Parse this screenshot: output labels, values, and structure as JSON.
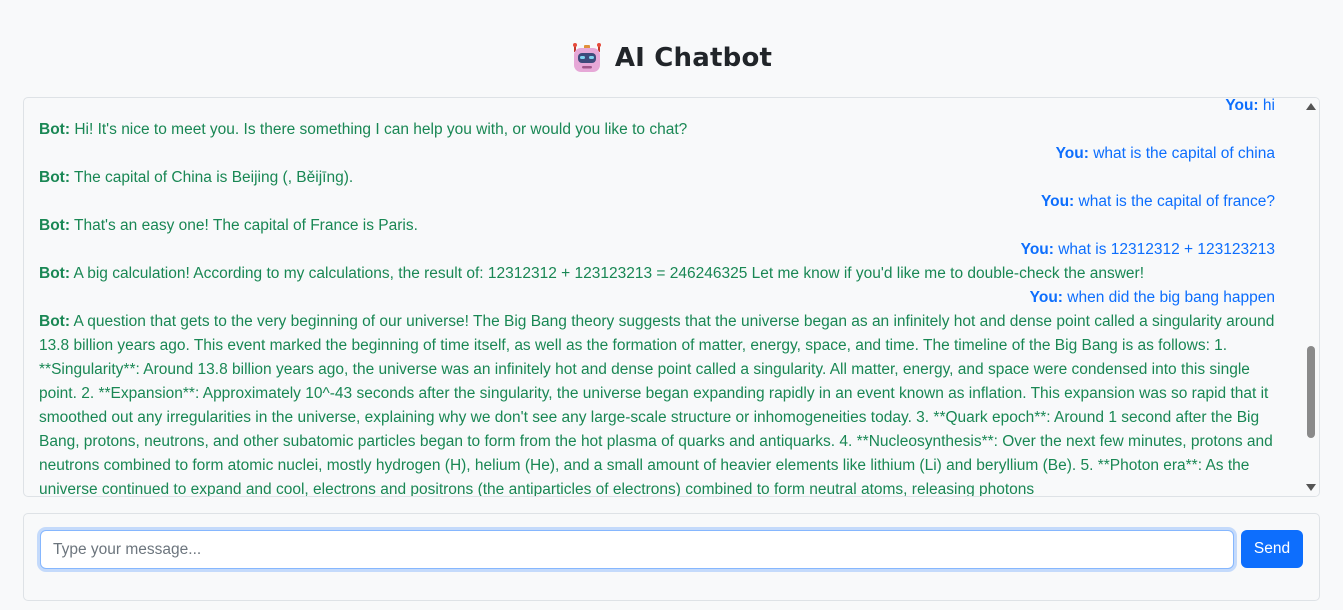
{
  "header": {
    "icon": "robot-icon",
    "title": "AI Chatbot"
  },
  "chat": {
    "user_label": "You:",
    "bot_label": "Bot:",
    "messages": [
      {
        "sender": "user",
        "text": "hi"
      },
      {
        "sender": "bot",
        "text": "Hi! It's nice to meet you. Is there something I can help you with, or would you like to chat?"
      },
      {
        "sender": "user",
        "text": "what is the capital of china"
      },
      {
        "sender": "bot",
        "text": "The capital of China is Beijing (, Běijīng)."
      },
      {
        "sender": "user",
        "text": "what is the capital of france?"
      },
      {
        "sender": "bot",
        "text": "That's an easy one! The capital of France is Paris."
      },
      {
        "sender": "user",
        "text": "what is 12312312 + 123123213"
      },
      {
        "sender": "bot",
        "text": "A big calculation! According to my calculations, the result of: 12312312 + 123123213 = 246246325 Let me know if you'd like me to double-check the answer!"
      },
      {
        "sender": "user",
        "text": "when did the big bang happen"
      },
      {
        "sender": "bot",
        "text": "A question that gets to the very beginning of our universe! The Big Bang theory suggests that the universe began as an infinitely hot and dense point called a singularity around 13.8 billion years ago. This event marked the beginning of time itself, as well as the formation of matter, energy, space, and time. The timeline of the Big Bang is as follows: 1. **Singularity**: Around 13.8 billion years ago, the universe was an infinitely hot and dense point called a singularity. All matter, energy, and space were condensed into this single point. 2. **Expansion**: Approximately 10^-43 seconds after the singularity, the universe began expanding rapidly in an event known as inflation. This expansion was so rapid that it smoothed out any irregularities in the universe, explaining why we don't see any large-scale structure or inhomogeneities today. 3. **Quark epoch**: Around 1 second after the Big Bang, protons, neutrons, and other subatomic particles began to form from the hot plasma of quarks and antiquarks. 4. **Nucleosynthesis**: Over the next few minutes, protons and neutrons combined to form atomic nuclei, mostly hydrogen (H), helium (He), and a small amount of heavier elements like lithium (Li) and beryllium (Be). 5. **Photon era**: As the universe continued to expand and cool, electrons and positrons (the antiparticles of electrons) combined to form neutral atoms, releasing photons"
      }
    ]
  },
  "input": {
    "placeholder": "Type your message...",
    "value": "",
    "send_label": "Send"
  },
  "colors": {
    "user": "#0d6efd",
    "bot": "#198754",
    "accent": "#0d6efd"
  }
}
